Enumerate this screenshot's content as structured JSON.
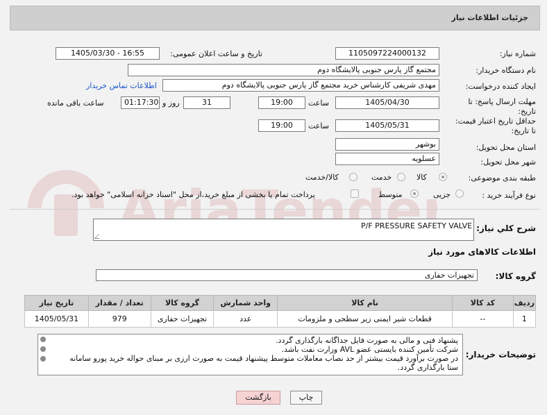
{
  "panel": {
    "title": "جزئیات اطلاعات نیاز"
  },
  "fields": {
    "need_number": {
      "label": "شماره نیاز:",
      "value": "1105097224000132"
    },
    "announce": {
      "label": "تاریخ و ساعت اعلان عمومی:",
      "value": "1405/03/30 - 16:55"
    },
    "buyer": {
      "label": "نام دستگاه خریدار:",
      "value": "مجتمع گاز پارس جنوبی  پالایشگاه دوم"
    },
    "requester": {
      "label": "ایجاد کننده درخواست:",
      "value": "مهدی شریفی کارشناس خرید مجتمع گاز پارس جنوبی  پالایشگاه دوم",
      "link": "اطلاعات تماس خریدار"
    },
    "reply_deadline": {
      "label_line1": "مهلت ارسال پاسخ: تا",
      "label_line2": "تاریخ:",
      "date": "1405/04/30",
      "time_label": "ساعت",
      "time": "19:00",
      "days": "31",
      "days_label": "روز و",
      "remaining": "01:17:30",
      "remaining_label": "ساعت باقی مانده"
    },
    "price_validity": {
      "label_line1": "حداقل تاریخ اعتبار قیمت:",
      "label_line2": "تا تاریخ:",
      "date": "1405/05/31",
      "time_label": "ساعت",
      "time": "19:00"
    },
    "province": {
      "label": "استان محل تحویل:",
      "value": "بوشهر"
    },
    "city": {
      "label": "شهر محل تحویل:",
      "value": "عسلویه"
    },
    "category": {
      "label": "طبقه بندی موضوعی:",
      "options": [
        "کالا",
        "خدمت",
        "کالا/خدمت"
      ],
      "selected": "کالا"
    },
    "process": {
      "label": "نوع فرآیند خرید :",
      "options": [
        "جزیی",
        "متوسط"
      ],
      "selected": "جزیی",
      "payment_note": "پرداخت تمام یا بخشی از مبلغ خرید،از محل \"اسناد خزانه اسلامی\" خواهد بود."
    }
  },
  "description": {
    "label": "شرح کلي نياز:",
    "value": "P/F PRESSURE SAFETY VALVE"
  },
  "goods_section": {
    "title": "اطلاعات کالاهای مورد نیاز"
  },
  "goods_group": {
    "label": "گروه کالا:",
    "value": "تجهیزات حفاری"
  },
  "table": {
    "headers": [
      "ردیف",
      "کد کالا",
      "نام کالا",
      "واحد شمارش",
      "گروه کالا",
      "تعداد / مقدار",
      "تاریخ نیاز"
    ],
    "rows": [
      [
        "1",
        "--",
        "قطعات شیر ایمنی زیر سطحی و ملزومات",
        "عدد",
        "تجهیزات حفاری",
        "979",
        "1405/05/31"
      ]
    ]
  },
  "buyer_notes": {
    "label": "توضیحات خریدار:",
    "lines": [
      "پشنهاد فنی و مالی به صورت فایل جداگانه بارگذاری گردد.",
      "شرکت تأمین کننده بایستی عضو AVL وزارت نفت باشد.",
      "در صورت برآورد قیمت بیشتر از حد نصاب معاملات متوسط پیشنهاد قیمت به صورت ارزی بر مبنای حواله خرید پورو سامانه",
      "ستا بارگذاری گردد."
    ]
  },
  "buttons": {
    "print": "چاپ",
    "back": "بازگشت"
  },
  "watermark": {
    "text": "AriaTender.net"
  },
  "colors": {
    "link": "#1a56c9",
    "back_button": "#f6d3d3",
    "header": "#cfcfcf"
  }
}
